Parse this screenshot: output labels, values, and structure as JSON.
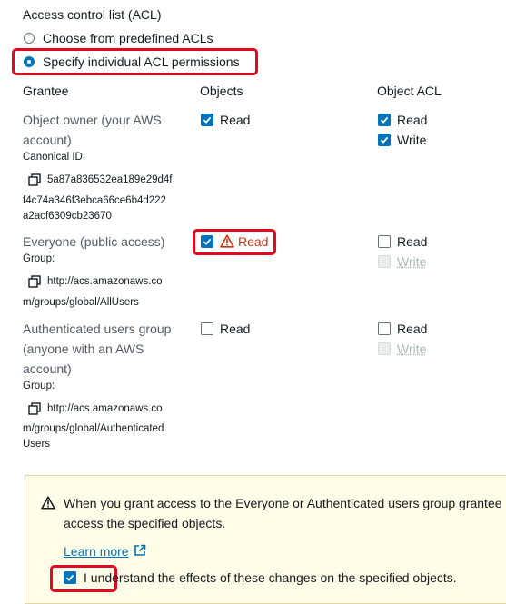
{
  "acl_section": {
    "title": "Access control list (ACL)",
    "options": [
      {
        "label": "Choose from predefined ACLs",
        "selected": false
      },
      {
        "label": "Specify individual ACL permissions",
        "selected": true
      }
    ]
  },
  "table": {
    "headers": {
      "grantee": "Grantee",
      "objects": "Objects",
      "object_acl": "Object ACL"
    },
    "rows": {
      "owner": {
        "name_line1": "Object owner (your AWS",
        "name_line2": "account)",
        "sub_label": "Canonical ID:",
        "id_line1": "5a87a836532ea189e29d4f",
        "id_line2": "f4c74a346f3ebca66ce6b4d222",
        "id_line3": "a2acf6309cb23670",
        "objects_read": {
          "label": "Read",
          "checked": true
        },
        "acl_read": {
          "label": "Read",
          "checked": true
        },
        "acl_write": {
          "label": "Write",
          "checked": true
        }
      },
      "everyone": {
        "name": "Everyone (public access)",
        "sub_label": "Group:",
        "uri_line1": "http://acs.amazonaws.co",
        "uri_line2": "m/groups/global/AllUsers",
        "objects_read": {
          "label": "Read",
          "checked": true,
          "warning": true
        },
        "acl_read": {
          "label": "Read",
          "checked": false
        },
        "acl_write": {
          "label": "Write",
          "checked": false,
          "disabled": true
        }
      },
      "authenticated": {
        "name_line1": "Authenticated users group",
        "name_line2": "(anyone with an AWS",
        "name_line3": "account)",
        "sub_label": "Group:",
        "uri_line1": "http://acs.amazonaws.co",
        "uri_line2": "m/groups/global/Authenticated",
        "uri_line3": "Users",
        "objects_read": {
          "label": "Read",
          "checked": false
        },
        "acl_read": {
          "label": "Read",
          "checked": false
        },
        "acl_write": {
          "label": "Write",
          "checked": false,
          "disabled": true
        }
      }
    }
  },
  "warning_panel": {
    "text_line1": "When you grant access to the Everyone or Authenticated users group grantee",
    "text_line2": "access the specified objects.",
    "learn_more": "Learn more",
    "ack_label": "I understand the effects of these changes on the specified objects.",
    "ack_checked": true
  },
  "colors": {
    "accent": "#0073bb",
    "highlight": "#e3081e",
    "warning_bg": "#fffce7"
  }
}
